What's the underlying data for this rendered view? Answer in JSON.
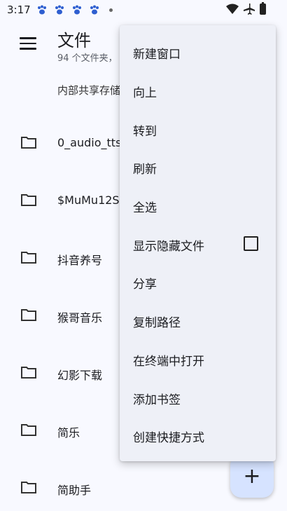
{
  "status_bar": {
    "time": "3:17"
  },
  "app_bar": {
    "title": "文件",
    "subtitle": "94 个文件夹，"
  },
  "breadcrumb": "内部共享存储",
  "files": [
    {
      "name": "0_audio_tts"
    },
    {
      "name": "$MuMu12S"
    },
    {
      "name": "抖音养号"
    },
    {
      "name": "猴哥音乐"
    },
    {
      "name": "幻影下载"
    },
    {
      "name": "简乐"
    },
    {
      "name": "简助手"
    }
  ],
  "menu": {
    "items": [
      {
        "label": "新建窗口"
      },
      {
        "label": "向上"
      },
      {
        "label": "转到"
      },
      {
        "label": "刷新"
      },
      {
        "label": "全选"
      },
      {
        "label": "显示隐藏文件",
        "checkbox": true
      },
      {
        "label": "分享"
      },
      {
        "label": "复制路径"
      },
      {
        "label": "在终端中打开"
      },
      {
        "label": "添加书签"
      },
      {
        "label": "创建快捷方式"
      }
    ]
  },
  "fab": {
    "label": "+"
  }
}
